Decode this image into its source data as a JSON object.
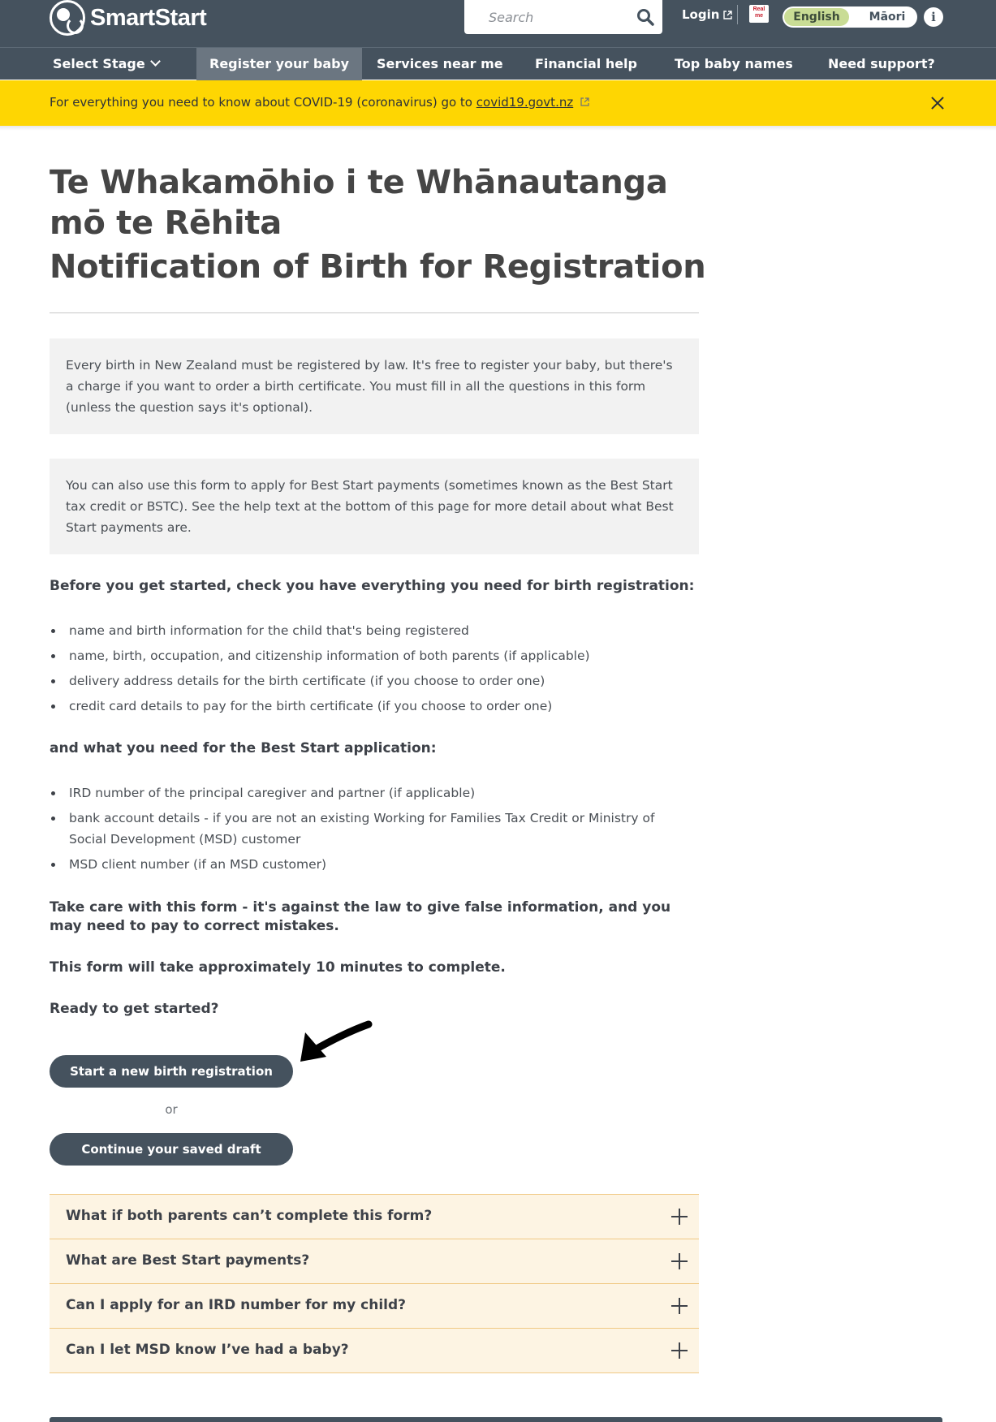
{
  "header": {
    "logo_text": "SmartStart",
    "search_placeholder": "Search",
    "login_label": "Login",
    "realme_label": "Real me",
    "lang_english": "English",
    "lang_maori": "Māori",
    "info_label": "i"
  },
  "nav": {
    "items": [
      {
        "label": "Select Stage"
      },
      {
        "label": "Register your baby"
      },
      {
        "label": "Services near me"
      },
      {
        "label": "Financial help"
      },
      {
        "label": "Top baby names"
      },
      {
        "label": "Need support?"
      }
    ],
    "active": "Register your baby"
  },
  "banner": {
    "text_before": "For everything you need to know about COVID-19 (coronavirus) go to ",
    "link_text": "covid19.govt.nz"
  },
  "page": {
    "title_maori": "Te Whakamōhio i te Whānautanga mō te Rēhita",
    "title_english": "Notification of Birth for Registration",
    "notice1": "Every birth in New Zealand must be registered by law. It's free to register your baby, but there's a charge if you want to order a birth certificate. You must fill in all the questions in this form (unless the question says it's optional).",
    "notice2": "You can also use this form to apply for Best Start payments (sometimes known as the Best Start tax credit or BSTC). See the help text at the bottom of this page for more detail about what Best Start payments are.",
    "checklist_heading": "Before you get started, check you have everything you need for birth registration:",
    "checklist": [
      "name and birth information for the child that's being registered",
      "name, birth, occupation, and citizenship information of both parents (if applicable)",
      "delivery address details for the birth certificate (if you choose to order one)",
      "credit card details to pay for the birth certificate (if you choose to order one)"
    ],
    "bst_heading": "and what you need for the Best Start application:",
    "bst_list": [
      "IRD number of the principal caregiver and partner (if applicable)",
      "bank account details - if you are not an existing Working for Families Tax Credit or Ministry of Social Development (MSD) customer",
      "MSD client number (if an MSD customer)"
    ],
    "warning": "Take care with this form - it's against the law to give false information, and you may need to pay to correct mistakes.",
    "duration": "This form will take approximately 10 minutes to complete.",
    "ready": "Ready to get started?",
    "start_button": "Start a new birth registration",
    "or_text": "or",
    "continue_button": "Continue your saved draft"
  },
  "accordion": [
    {
      "label": "What if both parents can’t complete this form?"
    },
    {
      "label": "What are Best Start payments?"
    },
    {
      "label": "Can I apply for an IRD number for my child?"
    },
    {
      "label": "Can I let MSD know I’ve had a baby?"
    }
  ],
  "colors": {
    "header_bg": "#45525e",
    "banner_bg": "#fed602",
    "accordion_bg": "#fdf4e3",
    "english_toggle": "#c9dc95"
  }
}
